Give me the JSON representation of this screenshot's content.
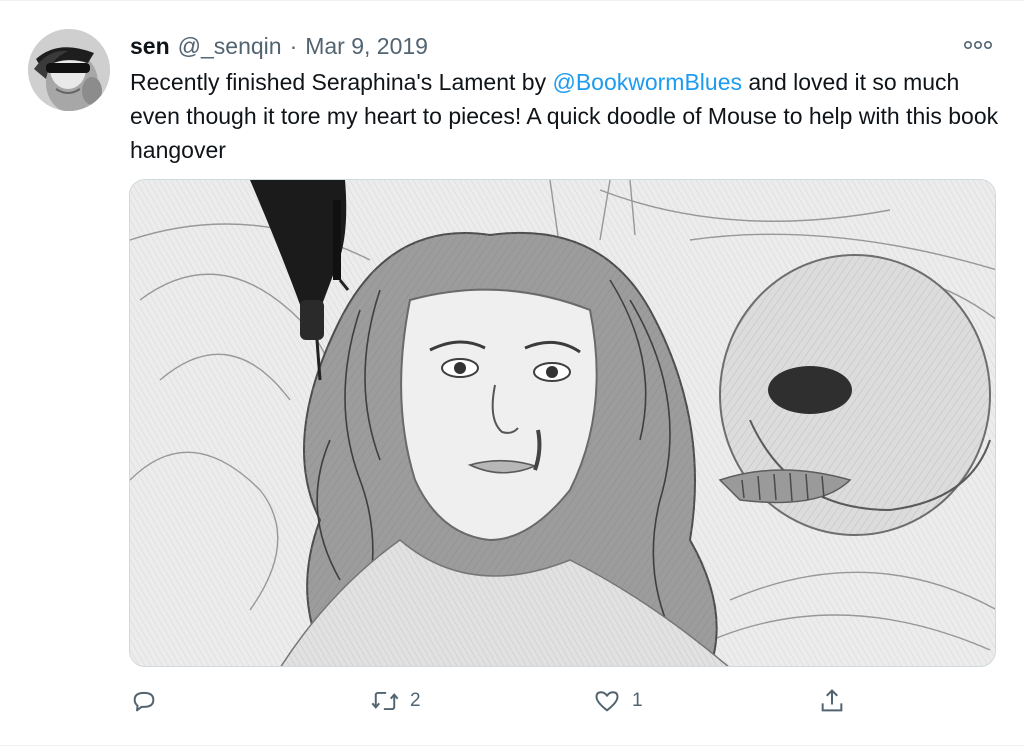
{
  "tweet": {
    "author_name": "sen",
    "author_handle": "@_senqin",
    "separator": "·",
    "date": "Mar 9, 2019",
    "text_before": "Recently finished Seraphina's Lament by ",
    "mention": "@BookwormBlues",
    "text_after": " and loved it so much even though it tore my heart to pieces! A quick doodle of Mouse to help with this book hangover",
    "media_alt": "Pencil sketch of a crying girl with long wavy hair beside a skull"
  },
  "actions": {
    "reply_count": "",
    "retweet_count": "2",
    "like_count": "1"
  },
  "icons": {
    "more": "more-options-icon",
    "reply": "reply-icon",
    "retweet": "retweet-icon",
    "like": "heart-icon",
    "share": "share-icon"
  },
  "colors": {
    "link": "#1d9bf0",
    "secondary_text": "#536471",
    "primary_text": "#0f1419"
  }
}
